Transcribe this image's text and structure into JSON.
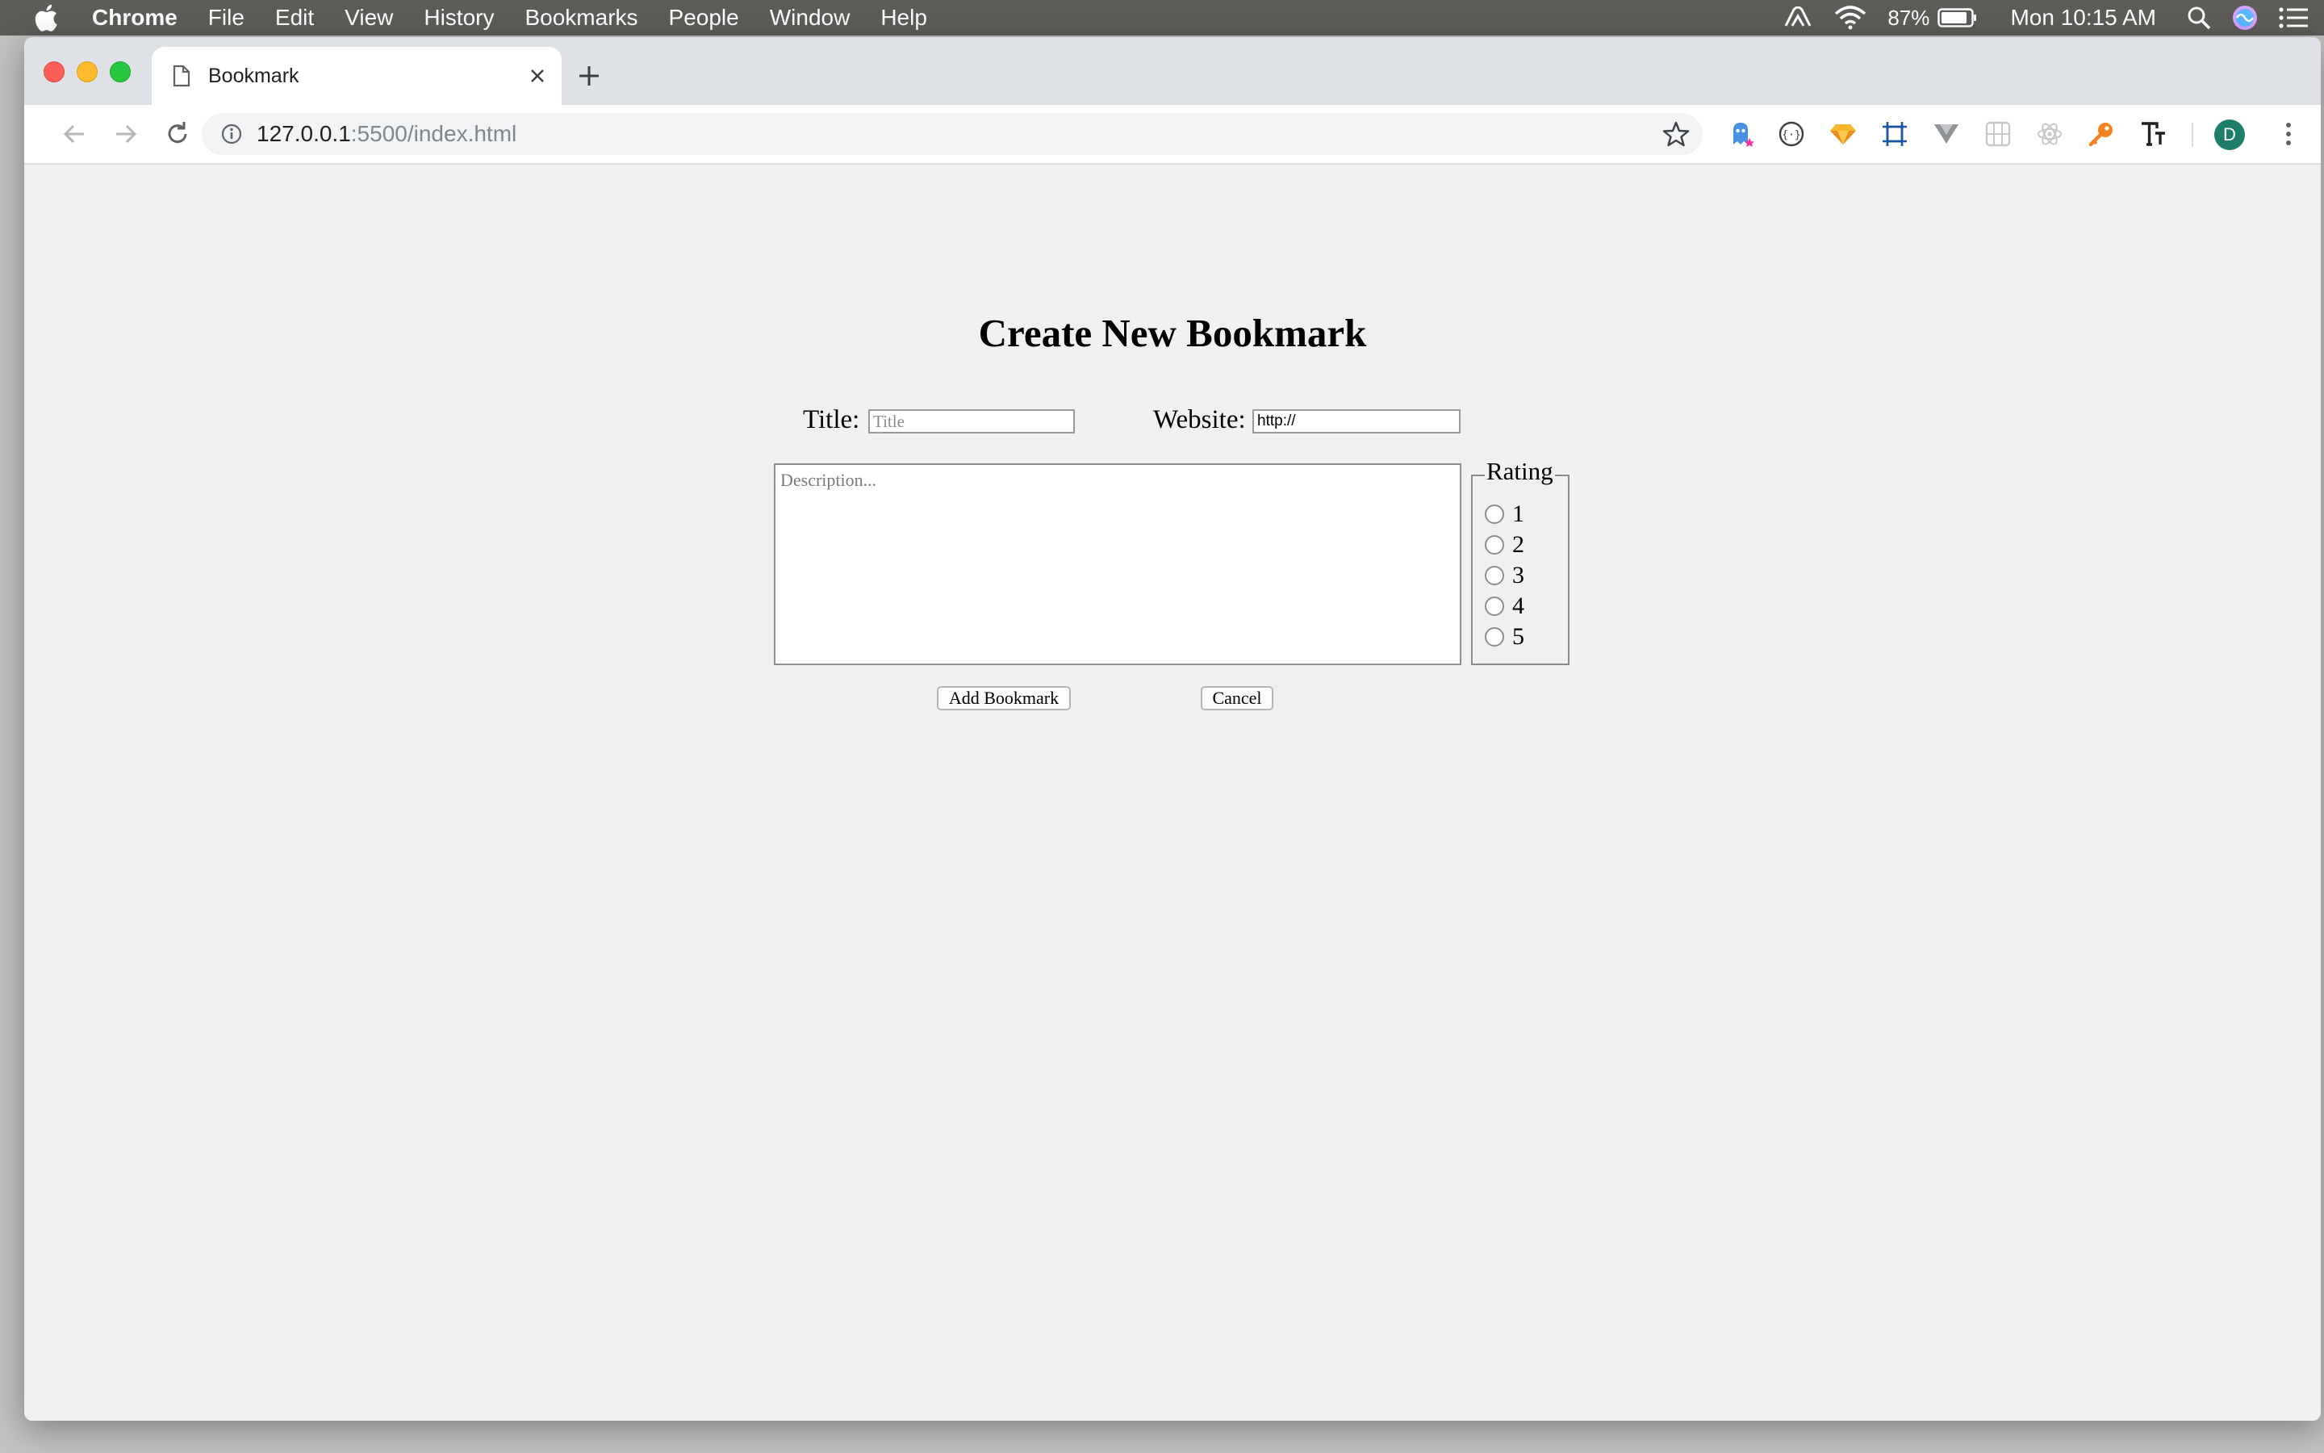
{
  "menubar": {
    "app": "Chrome",
    "items": [
      "File",
      "Edit",
      "View",
      "History",
      "Bookmarks",
      "People",
      "Window",
      "Help"
    ],
    "battery": "87%",
    "clock": "Mon 10:15 AM"
  },
  "browser": {
    "tab_title": "Bookmark",
    "url_host": "127.0.0.1",
    "url_path": ":5500/index.html",
    "profile_initial": "D"
  },
  "page": {
    "heading": "Create New Bookmark",
    "title_label": "Title:",
    "title_placeholder": "Title",
    "website_label": "Website:",
    "website_value": "http://",
    "description_placeholder": "Description...",
    "rating_legend": "Rating",
    "rating_options": [
      "1",
      "2",
      "3",
      "4",
      "5"
    ],
    "add_button": "Add Bookmark",
    "cancel_button": "Cancel"
  }
}
